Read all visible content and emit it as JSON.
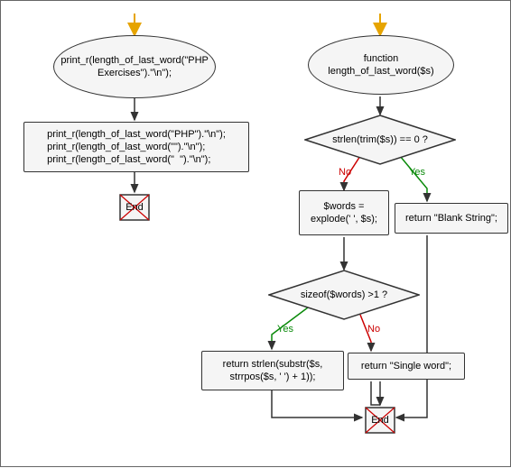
{
  "left": {
    "start_call": "print_r(length_of_last_word(\"PHP Exercises\").\"\\n\");",
    "calls_block": "print_r(length_of_last_word(\"PHP\").\"\\n\");\nprint_r(length_of_last_word(\"\").\"\\n\");\nprint_r(length_of_last_word(\"  \").\"\\n\");",
    "end": "End"
  },
  "right": {
    "func_header": "function length_of_last_word($s)",
    "cond1": "strlen(trim($s)) == 0 ?",
    "cond1_yes_label": "Yes",
    "cond1_no_label": "No",
    "return_blank": "return \"Blank String\";",
    "explode": "$words = explode(' ', $s);",
    "cond2": "sizeof($words) >1 ?",
    "cond2_yes_label": "Yes",
    "cond2_no_label": "No",
    "return_single": "return \"Single word\";",
    "return_len": "return strlen(substr($s, strrpos($s, ' ') + 1));",
    "end": "End"
  }
}
